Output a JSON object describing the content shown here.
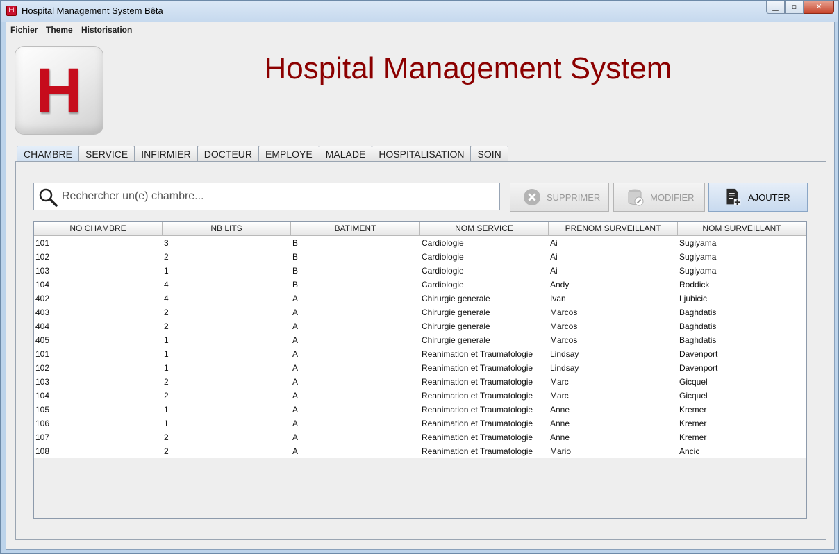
{
  "window": {
    "title": "Hospital Management System Bêta",
    "app_icon_letter": "H",
    "controls": {
      "minimize": "▁",
      "maximize": "▫",
      "close": "✕"
    }
  },
  "menubar": {
    "items": [
      {
        "label": "Fichier"
      },
      {
        "label": "Theme"
      },
      {
        "label": "Historisation"
      }
    ]
  },
  "header": {
    "logo_letter": "H",
    "title": "Hospital Management System"
  },
  "tabs": [
    {
      "label": "CHAMBRE",
      "active": true
    },
    {
      "label": "SERVICE"
    },
    {
      "label": "INFIRMIER"
    },
    {
      "label": "DOCTEUR"
    },
    {
      "label": "EMPLOYE"
    },
    {
      "label": "MALADE"
    },
    {
      "label": "HOSPITALISATION"
    },
    {
      "label": "SOIN"
    }
  ],
  "search": {
    "placeholder": "Rechercher un(e) chambre...",
    "value": "",
    "icon": "search-icon"
  },
  "toolbar": {
    "delete_label": "SUPPRIMER",
    "edit_label": "MODIFIER",
    "add_label": "AJOUTER",
    "delete_enabled": false,
    "edit_enabled": false
  },
  "table": {
    "columns": [
      "NO CHAMBRE",
      "NB LITS",
      "BATIMENT",
      "NOM SERVICE",
      "PRENOM SURVEILLANT",
      "NOM SURVEILLANT"
    ],
    "rows": [
      [
        "101",
        "3",
        "B",
        "Cardiologie",
        "Ai",
        "Sugiyama"
      ],
      [
        "102",
        "2",
        "B",
        "Cardiologie",
        "Ai",
        "Sugiyama"
      ],
      [
        "103",
        "1",
        "B",
        "Cardiologie",
        "Ai",
        "Sugiyama"
      ],
      [
        "104",
        "4",
        "B",
        "Cardiologie",
        "Andy",
        "Roddick"
      ],
      [
        "402",
        "4",
        "A",
        "Chirurgie generale",
        "Ivan",
        "Ljubicic"
      ],
      [
        "403",
        "2",
        "A",
        "Chirurgie generale",
        "Marcos",
        "Baghdatis"
      ],
      [
        "404",
        "2",
        "A",
        "Chirurgie generale",
        "Marcos",
        "Baghdatis"
      ],
      [
        "405",
        "1",
        "A",
        "Chirurgie generale",
        "Marcos",
        "Baghdatis"
      ],
      [
        "101",
        "1",
        "A",
        "Reanimation et Traumatologie",
        "Lindsay",
        "Davenport"
      ],
      [
        "102",
        "1",
        "A",
        "Reanimation et Traumatologie",
        "Lindsay",
        "Davenport"
      ],
      [
        "103",
        "2",
        "A",
        "Reanimation et Traumatologie",
        "Marc",
        "Gicquel"
      ],
      [
        "104",
        "2",
        "A",
        "Reanimation et Traumatologie",
        "Marc",
        "Gicquel"
      ],
      [
        "105",
        "1",
        "A",
        "Reanimation et Traumatologie",
        "Anne",
        "Kremer"
      ],
      [
        "106",
        "1",
        "A",
        "Reanimation et Traumatologie",
        "Anne",
        "Kremer"
      ],
      [
        "107",
        "2",
        "A",
        "Reanimation et Traumatologie",
        "Anne",
        "Kremer"
      ],
      [
        "108",
        "2",
        "A",
        "Reanimation et Traumatologie",
        "Mario",
        "Ancic"
      ]
    ]
  },
  "colors": {
    "title_red": "#8b0000",
    "logo_red": "#c60c1c",
    "window_frame": "#bcd3ea"
  }
}
